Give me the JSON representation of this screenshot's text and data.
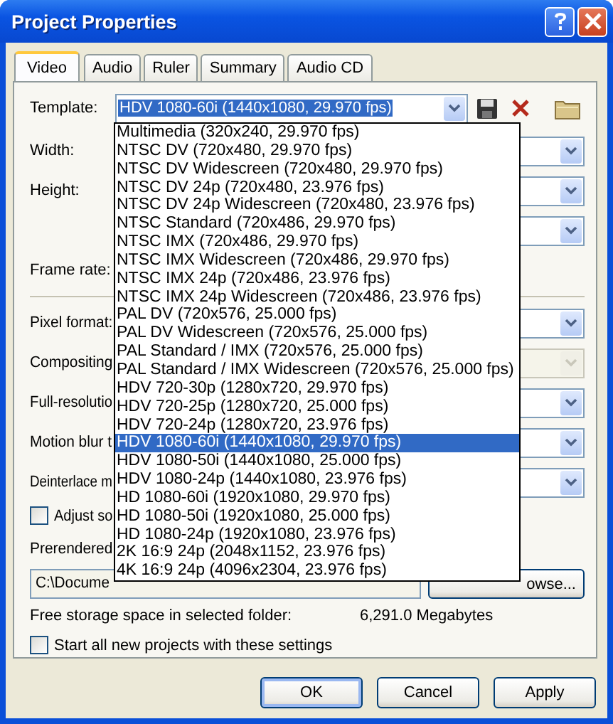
{
  "window": {
    "title": "Project Properties"
  },
  "tabs": [
    {
      "label": "Video",
      "selected": true
    },
    {
      "label": "Audio",
      "selected": false
    },
    {
      "label": "Ruler",
      "selected": false
    },
    {
      "label": "Summary",
      "selected": false
    },
    {
      "label": "Audio CD",
      "selected": false
    }
  ],
  "template": {
    "label": "Template:",
    "value": "HDV 1080-60i (1440x1080, 29.970 fps)",
    "expanded": true
  },
  "template_options": [
    {
      "label": "Multimedia (320x240, 29.970 fps)",
      "selected": false
    },
    {
      "label": "NTSC DV (720x480, 29.970 fps)",
      "selected": false
    },
    {
      "label": "NTSC DV Widescreen (720x480, 29.970 fps)",
      "selected": false
    },
    {
      "label": "NTSC DV 24p (720x480, 23.976 fps)",
      "selected": false
    },
    {
      "label": "NTSC DV 24p Widescreen (720x480, 23.976 fps)",
      "selected": false
    },
    {
      "label": "NTSC Standard (720x486, 29.970 fps)",
      "selected": false
    },
    {
      "label": "NTSC IMX (720x486, 29.970 fps)",
      "selected": false
    },
    {
      "label": "NTSC IMX Widescreen (720x486, 29.970 fps)",
      "selected": false
    },
    {
      "label": "NTSC IMX 24p (720x486, 23.976 fps)",
      "selected": false
    },
    {
      "label": "NTSC IMX 24p Widescreen (720x486, 23.976 fps)",
      "selected": false
    },
    {
      "label": "PAL DV (720x576, 25.000 fps)",
      "selected": false
    },
    {
      "label": "PAL DV Widescreen (720x576, 25.000 fps)",
      "selected": false
    },
    {
      "label": "PAL Standard / IMX (720x576, 25.000 fps)",
      "selected": false
    },
    {
      "label": "PAL Standard / IMX Widescreen (720x576, 25.000 fps)",
      "selected": false
    },
    {
      "label": "HDV 720-30p (1280x720, 29.970 fps)",
      "selected": false
    },
    {
      "label": "HDV 720-25p (1280x720, 25.000 fps)",
      "selected": false
    },
    {
      "label": "HDV 720-24p (1280x720, 23.976 fps)",
      "selected": false
    },
    {
      "label": "HDV 1080-60i (1440x1080, 29.970 fps)",
      "selected": true
    },
    {
      "label": "HDV 1080-50i (1440x1080, 25.000 fps)",
      "selected": false
    },
    {
      "label": "HDV 1080-24p (1440x1080, 23.976 fps)",
      "selected": false
    },
    {
      "label": "HD 1080-60i (1920x1080, 29.970 fps)",
      "selected": false
    },
    {
      "label": "HD 1080-50i (1920x1080, 25.000 fps)",
      "selected": false
    },
    {
      "label": "HD 1080-24p (1920x1080, 23.976 fps)",
      "selected": false
    },
    {
      "label": "2K 16:9 24p (2048x1152, 23.976 fps)",
      "selected": false
    },
    {
      "label": "4K 16:9 24p (4096x2304, 23.976 fps)",
      "selected": false
    }
  ],
  "settings": [
    {
      "kind": "combo",
      "label": "Width:",
      "disabled": false
    },
    {
      "kind": "combo",
      "label": "Height:",
      "disabled": false
    },
    {
      "kind": "combo",
      "disabled": false
    },
    {
      "kind": "label",
      "label": "Frame rate:"
    },
    {
      "kind": "separator"
    },
    {
      "kind": "combo",
      "label": "Pixel format:",
      "disabled": false
    },
    {
      "kind": "combo",
      "label": "Compositing",
      "disabled": true
    },
    {
      "kind": "combo",
      "label": "Full-resolutio",
      "disabled": false
    },
    {
      "kind": "combo",
      "label": "Motion blur t",
      "disabled": false
    },
    {
      "kind": "combo",
      "label": "Deinterlace m",
      "disabled": false
    },
    {
      "kind": "checkbox",
      "label": "Adjust so",
      "checked": false
    },
    {
      "kind": "label",
      "label": "Prerendered"
    },
    {
      "kind": "path",
      "value": "C:\\Docume",
      "button": "owse..."
    },
    {
      "kind": "info",
      "label": "Free storage space in selected folder:",
      "value": "6,291.0 Megabytes"
    },
    {
      "kind": "checkbox",
      "label": "Start all new projects with these settings",
      "checked": false
    }
  ],
  "buttons": [
    {
      "label": "OK",
      "default": true
    },
    {
      "label": "Cancel",
      "default": false
    },
    {
      "label": "Apply",
      "default": false
    }
  ]
}
